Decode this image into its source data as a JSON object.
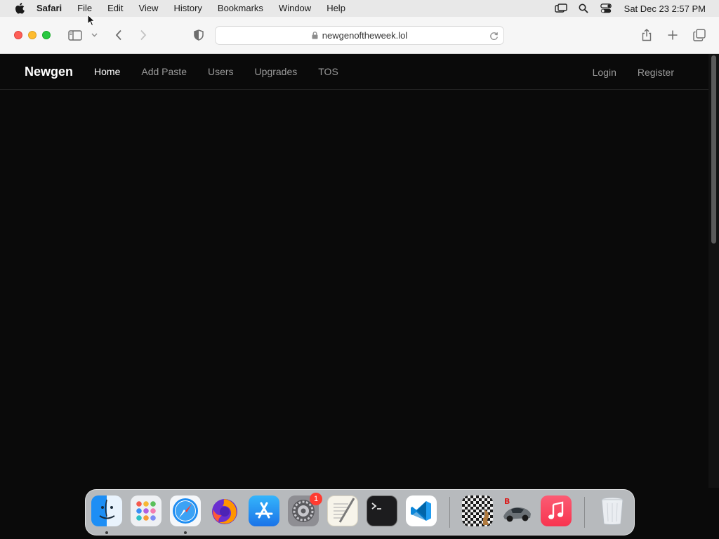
{
  "menubar": {
    "app_name": "Safari",
    "items": [
      "File",
      "Edit",
      "View",
      "History",
      "Bookmarks",
      "Window",
      "Help"
    ],
    "clock": "Sat Dec 23  2:57 PM"
  },
  "browser": {
    "url": "newgenoftheweek.lol"
  },
  "site": {
    "brand": "Newgen",
    "nav_links": [
      "Home",
      "Add Paste",
      "Users",
      "Upgrades",
      "TOS"
    ],
    "active_link": "Home",
    "auth_links": [
      "Login",
      "Register"
    ]
  },
  "dock": {
    "apps": [
      "finder-icon",
      "launchpad-icon",
      "safari-icon",
      "firefox-icon",
      "app-store-icon",
      "system-settings-icon",
      "textedit-icon",
      "terminal-icon",
      "vscode-icon",
      "chess-icon",
      "racing-game-icon",
      "music-icon",
      "trash-icon"
    ],
    "settings_badge": "1"
  },
  "colors": {
    "page_background": "#0a0a0a",
    "nav_active": "#ffffff",
    "nav_inactive": "#9a9a9a"
  }
}
